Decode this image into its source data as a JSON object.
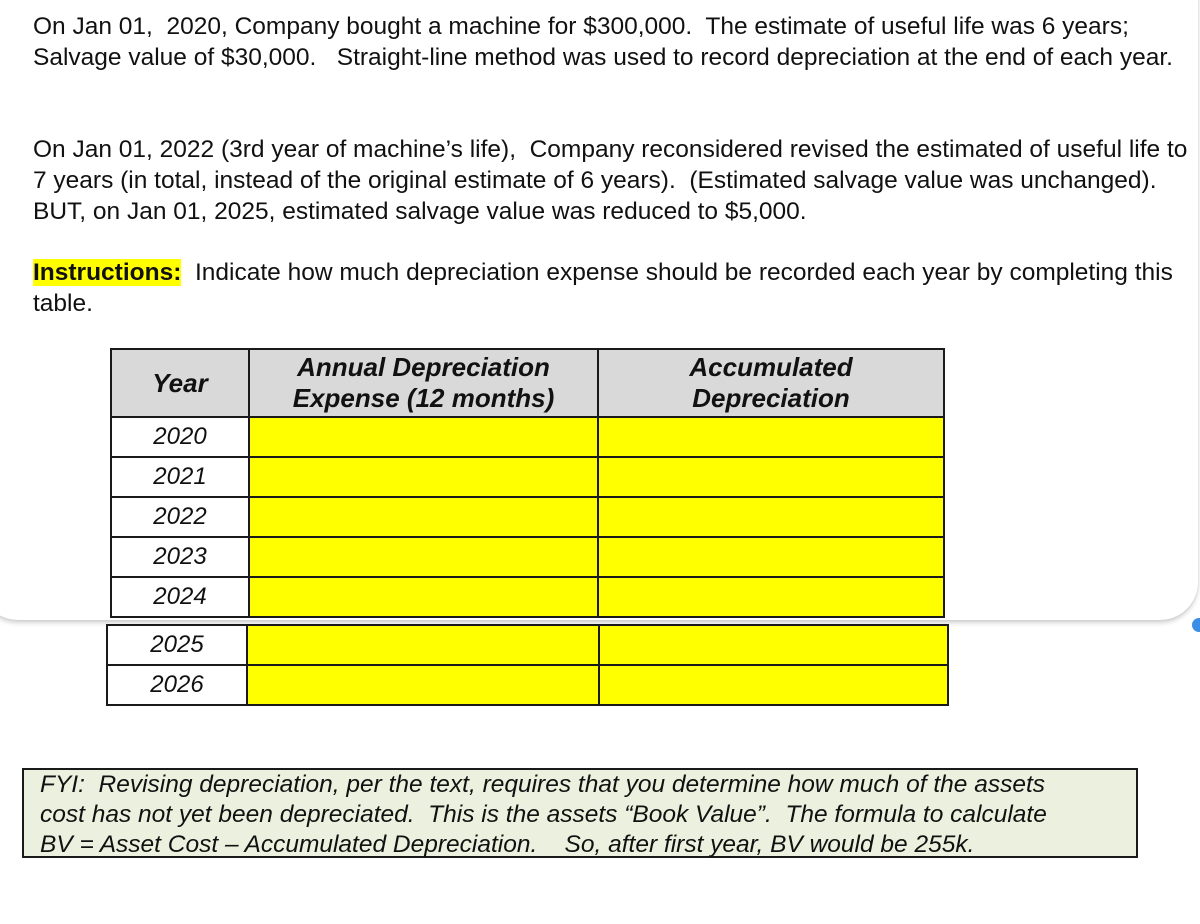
{
  "problem": {
    "paragraph1": "On Jan 01,  2020, Company bought a machine for $300,000.  The estimate of useful life was 6 years;  Salvage value of $30,000.   Straight-line method was used to record depreciation at the end of each year.",
    "paragraph2": "On Jan 01, 2022 (3rd year of machine’s life),  Company reconsidered revised the estimated of useful life to 7 years (in total, instead of the original estimate of 6 years).  (Estimated salvage value was unchanged).  BUT, on Jan 01, 2025, estimated salvage value was reduced to $5,000.",
    "instructions_label": "Instructions:",
    "instructions_text": "  Indicate how much depreciation expense should be recorded each year by completing this table."
  },
  "table": {
    "headers": {
      "year": "Year",
      "expense_line1": "Annual Depreciation",
      "expense_line2": "Expense  (12 months)",
      "accum_line1": "Accumulated",
      "accum_line2": "Depreciation"
    },
    "rows": [
      {
        "year": "2020",
        "expense": "",
        "accumulated": ""
      },
      {
        "year": "2021",
        "expense": "",
        "accumulated": ""
      },
      {
        "year": "2022",
        "expense": "",
        "accumulated": ""
      },
      {
        "year": "2023",
        "expense": "",
        "accumulated": ""
      },
      {
        "year": "2024",
        "expense": "",
        "accumulated": ""
      },
      {
        "year": "2025",
        "expense": "",
        "accumulated": ""
      },
      {
        "year": "2026",
        "expense": "",
        "accumulated": ""
      }
    ]
  },
  "fyi": {
    "line1": "FYI:  Revising depreciation, per the text, requires that you determine how much of the assets",
    "line2": "cost has not yet been depreciated.  This is the assets “Book Value”.  The formula to calculate",
    "line3": "BV = Asset Cost – Accumulated Depreciation.    So, after first year, BV would be 255k."
  },
  "colors": {
    "highlight": "#ffff00",
    "header_bg": "#d9d9d9",
    "fyi_bg": "#ebf1de",
    "indicator": "#3a8ee6"
  }
}
